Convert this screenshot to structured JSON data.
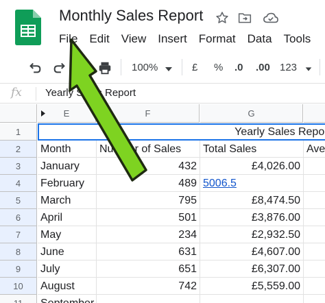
{
  "doc": {
    "title": "Monthly Sales Report",
    "menu": [
      "File",
      "Edit",
      "View",
      "Insert",
      "Format",
      "Data",
      "Tools"
    ]
  },
  "toolbar": {
    "zoom": "100%",
    "currency": "£",
    "percent": "%",
    "decrease_decimals": ".0",
    "increase_decimals": ".00",
    "more_formats": "123"
  },
  "formula_bar": {
    "fx": "fx",
    "value": "Yearly Sales Report"
  },
  "grid": {
    "columns": [
      "E",
      "F",
      "G"
    ],
    "rows": [
      "1",
      "2",
      "3",
      "4",
      "5",
      "6",
      "7",
      "8",
      "9",
      "10",
      "11"
    ],
    "merged_title": "Yearly Sales Report",
    "headers": [
      "Month",
      "Number of Sales",
      "Total Sales",
      "Ave"
    ],
    "data": [
      {
        "month": "January",
        "sales": "432",
        "total": "£4,026.00"
      },
      {
        "month": "February",
        "sales": "489",
        "total": "5006.5"
      },
      {
        "month": "March",
        "sales": "795",
        "total": "£8,474.50"
      },
      {
        "month": "April",
        "sales": "501",
        "total": "£3,876.00"
      },
      {
        "month": "May",
        "sales": "234",
        "total": "£2,932.50"
      },
      {
        "month": "June",
        "sales": "631",
        "total": "£4,607.00"
      },
      {
        "month": "July",
        "sales": "651",
        "total": "£6,307.00"
      },
      {
        "month": "August",
        "sales": "742",
        "total": "£5,559.00"
      },
      {
        "month": "September",
        "sales": "",
        "total": ""
      }
    ]
  },
  "colors": {
    "sheets_green": "#0f9d58",
    "arrow_green": "#7ed321",
    "selection_blue": "#1a73e8",
    "link_blue": "#1155cc"
  },
  "icons": [
    "star-icon",
    "move-to-folder-icon",
    "cloud-status-icon",
    "undo-icon",
    "redo-icon",
    "print-icon",
    "chevron-down-icon"
  ]
}
